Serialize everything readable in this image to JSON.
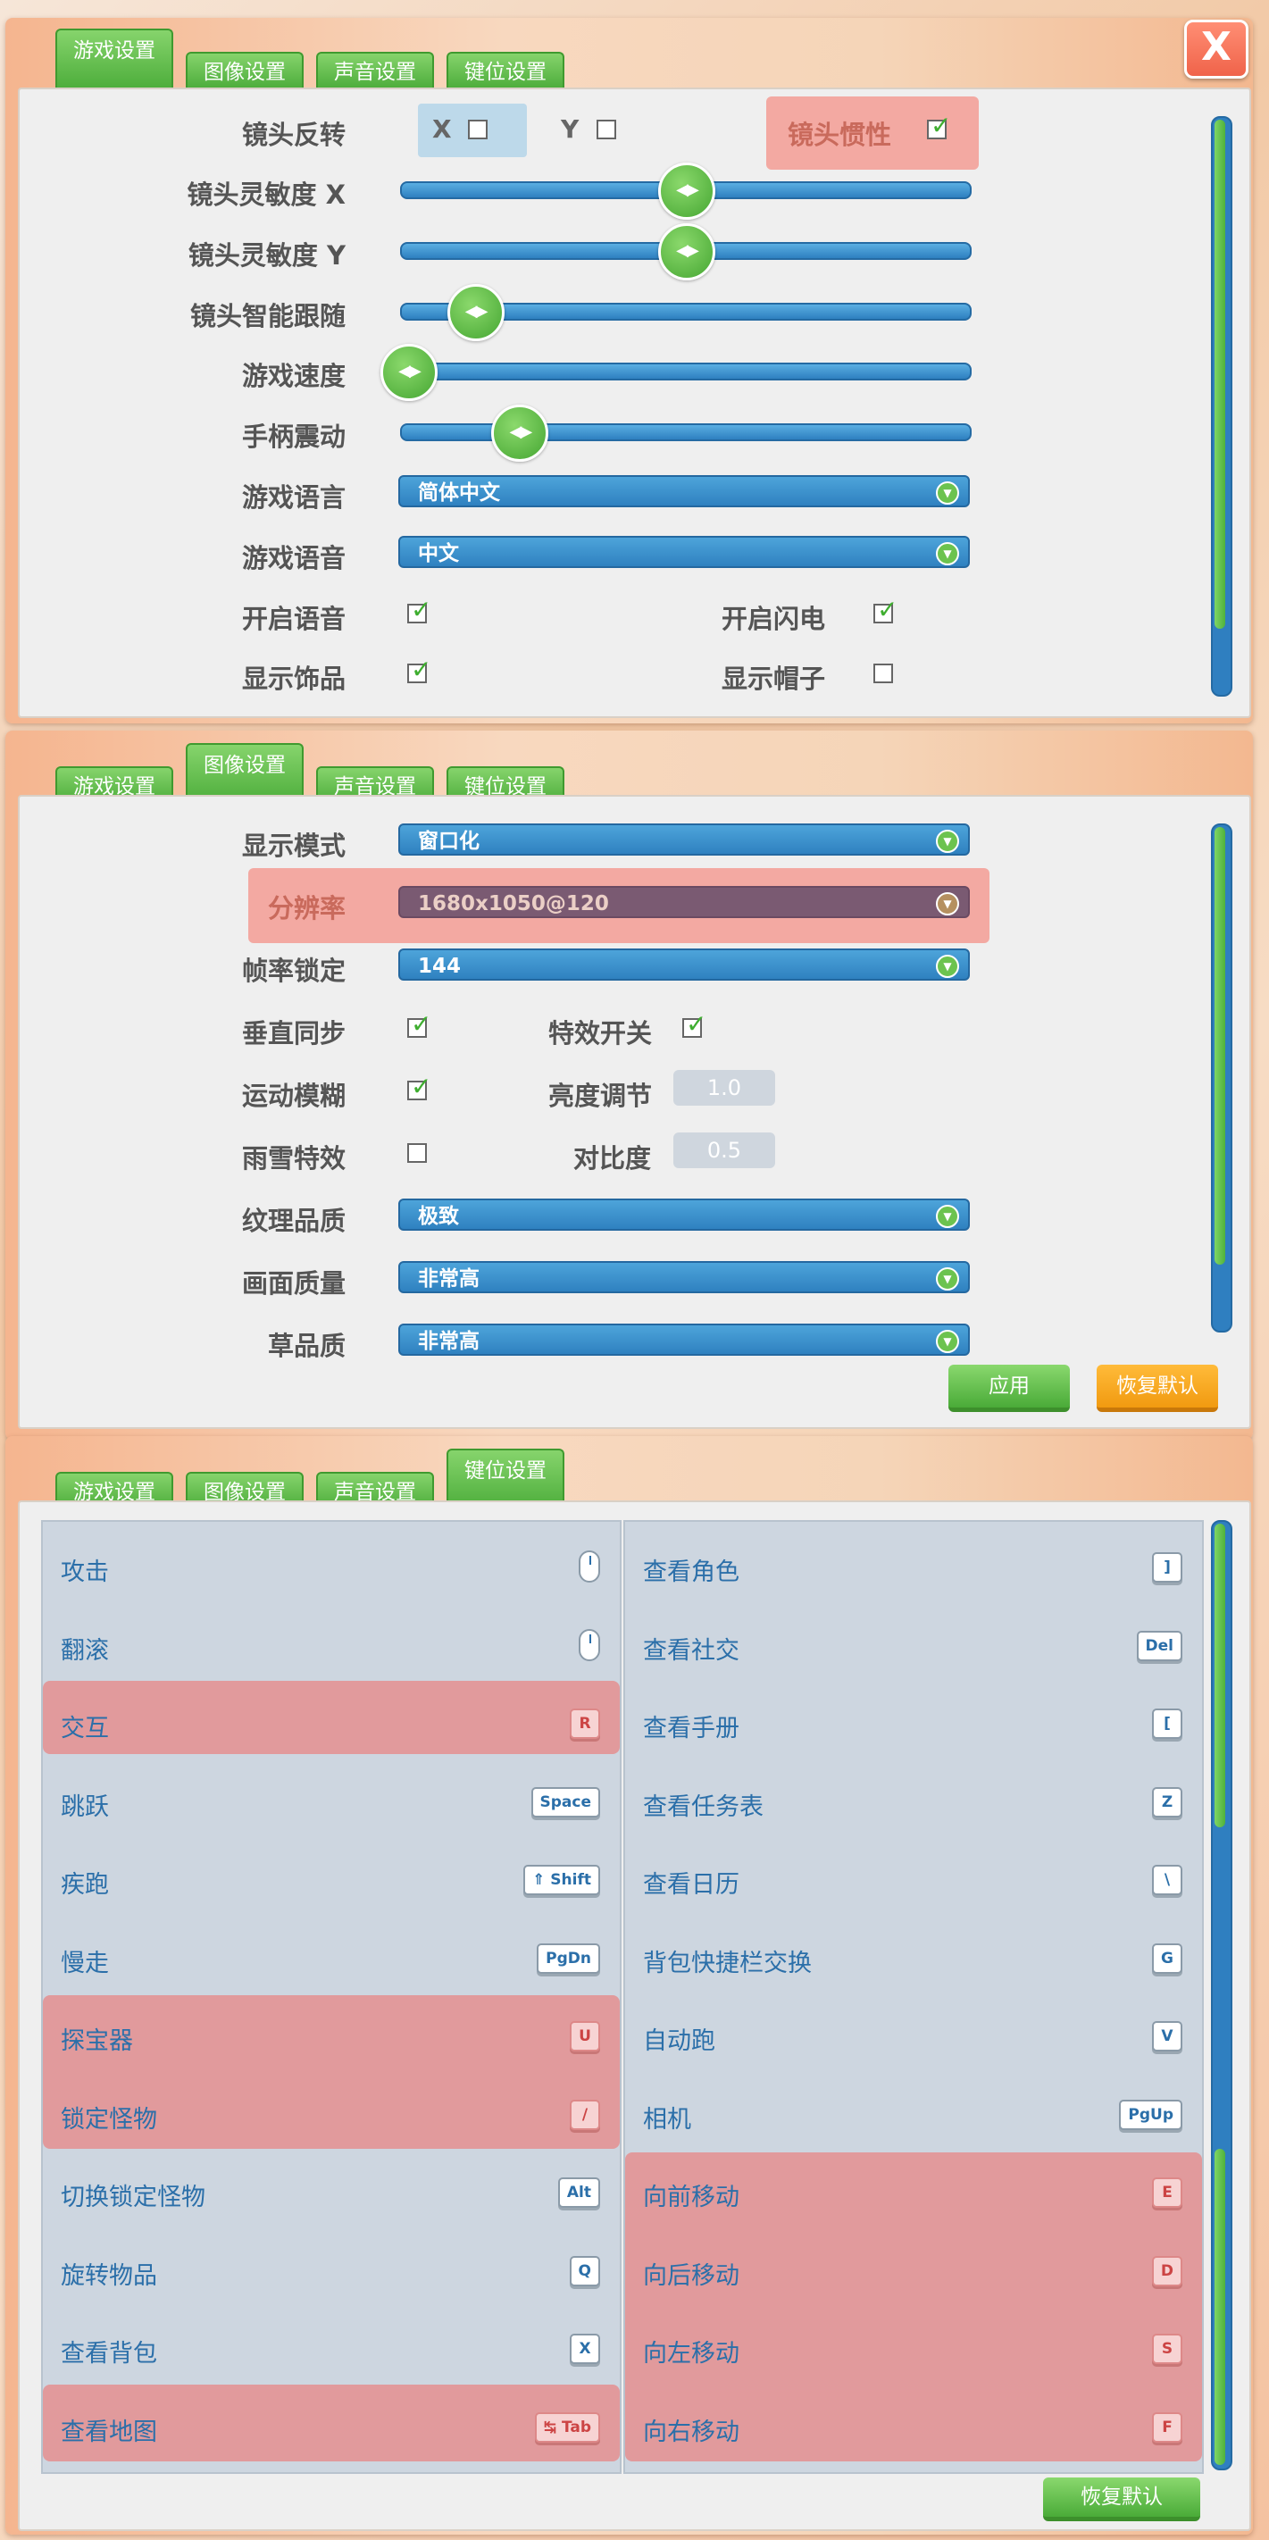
{
  "tabs": [
    "游戏设置",
    "图像设置",
    "声音设置",
    "键位设置"
  ],
  "close_label": "X",
  "game": {
    "camera_invert_label": "镜头反转",
    "invert_x": "X",
    "invert_y": "Y",
    "inertia_label": "镜头惯性",
    "sens_x_label": "镜头灵敏度 X",
    "sens_y_label": "镜头灵敏度 Y",
    "smart_follow_label": "镜头智能跟随",
    "speed_label": "游戏速度",
    "vibration_label": "手柄震动",
    "language_label": "游戏语言",
    "language_value": "简体中文",
    "voice_label": "游戏语音",
    "voice_value": "中文",
    "enable_voice_label": "开启语音",
    "enable_lightning_label": "开启闪电",
    "show_accessory_label": "显示饰品",
    "show_hat_label": "显示帽子",
    "levels": {
      "sens_x": 0.5,
      "sens_y": 0.5,
      "smart_follow": 0.12,
      "speed": 0.0,
      "vibration": 0.2
    },
    "checks": {
      "invert_x": false,
      "invert_y": false,
      "inertia": true,
      "voice": true,
      "lightning": true,
      "accessory": true,
      "hat": false
    }
  },
  "graphics": {
    "display_mode_label": "显示模式",
    "display_mode_value": "窗口化",
    "resolution_label": "分辨率",
    "resolution_value": "1680x1050@120",
    "fps_label": "帧率锁定",
    "fps_value": "144",
    "vsync_label": "垂直同步",
    "effects_label": "特效开关",
    "motion_blur_label": "运动模糊",
    "brightness_label": "亮度调节",
    "brightness_value": "1.0",
    "weather_label": "雨雪特效",
    "contrast_label": "对比度",
    "contrast_value": "0.5",
    "texture_label": "纹理品质",
    "texture_value": "极致",
    "quality_label": "画面质量",
    "quality_value": "非常高",
    "grass_label": "草品质",
    "grass_value": "非常高",
    "apply_label": "应用",
    "reset_label": "恢复默认",
    "checks": {
      "vsync": true,
      "effects": true,
      "motion_blur": true,
      "weather": false
    }
  },
  "keys": {
    "reset_label": "恢复默认",
    "left": [
      {
        "label": "攻击",
        "key": ""
      },
      {
        "label": "翻滚",
        "key": ""
      },
      {
        "label": "交互",
        "key": "R"
      },
      {
        "label": "跳跃",
        "key": "Space"
      },
      {
        "label": "疾跑",
        "key": "⇑ Shift"
      },
      {
        "label": "慢走",
        "key": "PgDn"
      },
      {
        "label": "探宝器",
        "key": "U"
      },
      {
        "label": "锁定怪物",
        "key": "/"
      },
      {
        "label": "切换锁定怪物",
        "key": "Alt"
      },
      {
        "label": "旋转物品",
        "key": "Q"
      },
      {
        "label": "查看背包",
        "key": "X"
      },
      {
        "label": "查看地图",
        "key": "↹ Tab"
      }
    ],
    "right": [
      {
        "label": "查看角色",
        "key": "]"
      },
      {
        "label": "查看社交",
        "key": "Del"
      },
      {
        "label": "查看手册",
        "key": "["
      },
      {
        "label": "查看任务表",
        "key": "Z"
      },
      {
        "label": "查看日历",
        "key": "\\"
      },
      {
        "label": "背包快捷栏交换",
        "key": "G"
      },
      {
        "label": "自动跑",
        "key": "V"
      },
      {
        "label": "相机",
        "key": "PgUp"
      },
      {
        "label": "向前移动",
        "key": "E"
      },
      {
        "label": "向后移动",
        "key": "D"
      },
      {
        "label": "向左移动",
        "key": "S"
      },
      {
        "label": "向右移动",
        "key": "F"
      }
    ]
  }
}
